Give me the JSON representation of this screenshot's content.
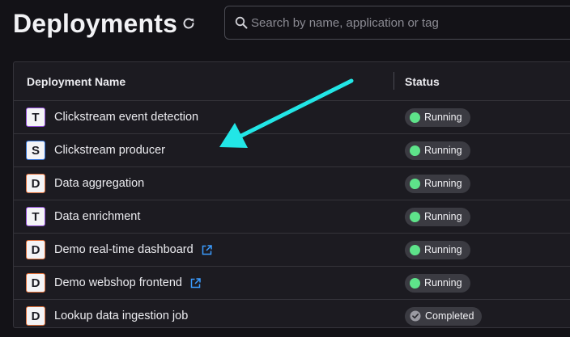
{
  "header": {
    "title": "Deployments"
  },
  "search": {
    "placeholder": "Search by name, application or tag"
  },
  "table": {
    "columns": {
      "name": "Deployment Name",
      "status": "Status"
    },
    "rows": [
      {
        "type": "T",
        "name": "Clickstream event detection",
        "external_link": false,
        "status": "Running"
      },
      {
        "type": "S",
        "name": "Clickstream producer",
        "external_link": false,
        "status": "Running"
      },
      {
        "type": "D",
        "name": "Data aggregation",
        "external_link": false,
        "status": "Running"
      },
      {
        "type": "T",
        "name": "Data enrichment",
        "external_link": false,
        "status": "Running"
      },
      {
        "type": "D",
        "name": "Demo real-time dashboard",
        "external_link": true,
        "status": "Running"
      },
      {
        "type": "D",
        "name": "Demo webshop frontend",
        "external_link": true,
        "status": "Running"
      },
      {
        "type": "D",
        "name": "Lookup data ingestion job",
        "external_link": false,
        "status": "Completed"
      }
    ]
  },
  "colors": {
    "background": "#131217",
    "table_bg": "#1c1b21",
    "running": "#5ee38a",
    "annotation_arrow": "#22e6e6",
    "type_T": "#8f4bd6",
    "type_S": "#2f6fd8",
    "type_D": "#e2703a",
    "link": "#3b9cff"
  },
  "icons": {
    "refresh": "refresh-icon",
    "search": "search-icon",
    "external_link": "external-link-icon",
    "running": "running-status-dot",
    "completed": "check-circle-icon"
  }
}
